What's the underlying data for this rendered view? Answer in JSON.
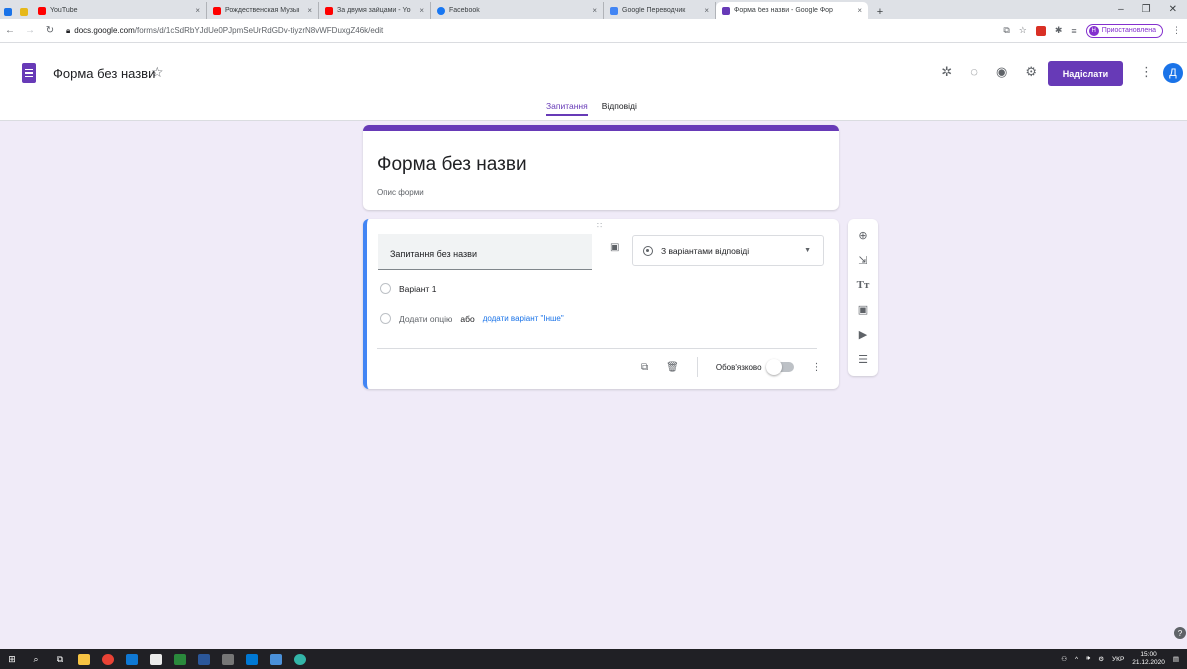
{
  "browser": {
    "tabs": [
      {
        "title": "",
        "favicon_color": "#1a73e8"
      },
      {
        "title": "",
        "favicon_color": "#e6b81a"
      },
      {
        "title": "YouTube",
        "favicon_color": "#ff0000"
      },
      {
        "title": "Рождественская Музыка - Самы",
        "favicon_color": "#ff0000"
      },
      {
        "title": "За двумя зайцами - YouTube",
        "favicon_color": "#ff0000"
      },
      {
        "title": "Facebook",
        "favicon_color": "#1877f2"
      },
      {
        "title": "Google Переводчик",
        "favicon_color": "#4285f4"
      },
      {
        "title": "Форма без назви - Google Фор",
        "favicon_color": "#673ab7"
      }
    ],
    "new_tab": "+",
    "close_glyph": "×",
    "window_controls": {
      "minimize": "–",
      "maximize": "❐",
      "close": "✕"
    },
    "url_host": "docs.google.com",
    "url_path": "/forms/d/1cSdRbYJdUe0PJpmSeUrRdGDv-tiyzrN8vWFDuxgZ46k/edit",
    "profile_initial": "Н",
    "profile_status": "Приостановлена"
  },
  "header": {
    "doc_title": "Форма без назви",
    "send_label": "Надіслати",
    "avatar_initial": "Д",
    "tabs": [
      "Запитання",
      "Відповіді"
    ]
  },
  "form": {
    "title": "Форма без назви",
    "description": "Опис форми"
  },
  "question": {
    "title": "Запитання без назви",
    "type_label": "З варіантами відповіді",
    "option1": "Варіант 1",
    "add_option": "Додати опцію",
    "or_text": "або",
    "add_other": "додати варіант \"Інше\"",
    "required_label": "Обов'язково",
    "required_on": false
  },
  "colors": {
    "accent": "#673ab7",
    "question_bar": "#4285f4",
    "page_bg": "#f0ebf8"
  },
  "taskbar": {
    "lang": "УКР",
    "time": "15:00",
    "date": "21.12.2020"
  }
}
